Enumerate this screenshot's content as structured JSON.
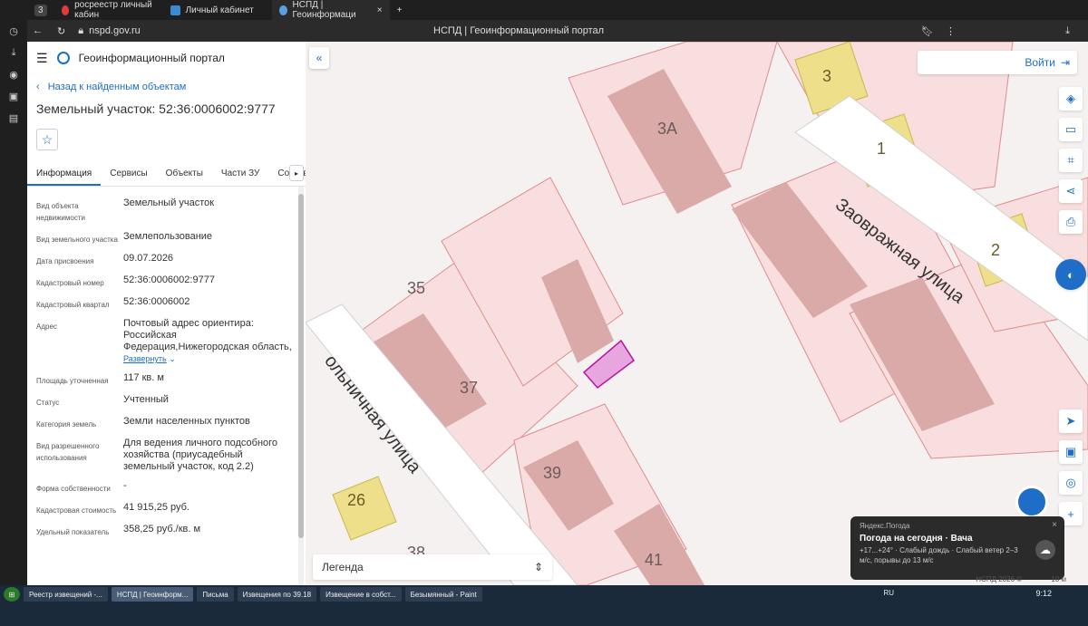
{
  "browser": {
    "tabs": [
      {
        "label": "росреестр личный кабин",
        "active": false
      },
      {
        "label": "Личный кабинет",
        "active": false
      },
      {
        "label": "НСПД | Геоинформаци",
        "active": true
      }
    ],
    "tab_count": "3",
    "url": "nspd.gov.ru",
    "page_title": "НСПД | Геоинформационный портал",
    "login_badge": "Войти"
  },
  "panel": {
    "portal_name": "Геоинформационный портал",
    "back_label": "Назад к найденным объектам",
    "title": "Земельный участок: 52:36:0006002:9777",
    "tabs": [
      "Информация",
      "Сервисы",
      "Объекты",
      "Части ЗУ",
      "Состав"
    ],
    "properties": [
      {
        "key": "Вид объекта недвижимости",
        "value": "Земельный участок"
      },
      {
        "key": "Вид земельного участка",
        "value": "Землепользование"
      },
      {
        "key": "Дата присвоения",
        "value": "09.07.2026"
      },
      {
        "key": "Кадастровый номер",
        "value": "52:36:0006002:9777"
      },
      {
        "key": "Кадастровый квартал",
        "value": "52:36:0006002"
      },
      {
        "key": "Адрес",
        "value": "Почтовый адрес ориентира: Российская Федерация,Нижегородская область,"
      },
      {
        "key": "Площадь уточненная",
        "value": "117 кв. м"
      },
      {
        "key": "Статус",
        "value": "Учтенный"
      },
      {
        "key": "Категория земель",
        "value": "Земли населенных пунктов"
      },
      {
        "key": "Вид разрешенного использования",
        "value": "Для ведения личного подсобного хозяйства (приусадебный земельный участок, код 2.2)"
      },
      {
        "key": "Форма собственности",
        "value": "-"
      },
      {
        "key": "Кадастровая стоимость",
        "value": "41 915,25 руб."
      },
      {
        "key": "Удельный показатель",
        "value": "358,25 руб./кв. м"
      }
    ],
    "expand_label": "Развернуть"
  },
  "map": {
    "login_label": "Войти",
    "legend_label": "Легенда",
    "streets": [
      "Заовражная улица",
      "ольничная улица"
    ],
    "house_numbers": [
      "3",
      "3А",
      "1",
      "2",
      "35",
      "37",
      "39",
      "26",
      "38",
      "41"
    ],
    "scale_label": "10 м",
    "copyright": "НСПД 2026 ©"
  },
  "weather": {
    "source": "Яндекс.Погода",
    "headline": "Погода на сегодня · Вача",
    "details": "+17...+24° · Слабый дождь · Слабый ветер 2–3 м/с, порывы до 13 м/с"
  },
  "taskbar": {
    "items": [
      {
        "label": "Реестр извещений -...",
        "active": false
      },
      {
        "label": "НСПД | Геоинформ...",
        "active": true
      },
      {
        "label": "Письма",
        "active": false
      },
      {
        "label": "Извещения по 39.18",
        "active": false
      },
      {
        "label": "Извещение в собст...",
        "active": false
      },
      {
        "label": "Безымянный - Paint",
        "active": false
      }
    ],
    "lang": "RU",
    "clock": "9:12"
  },
  "colors": {
    "accent": "#1e6ec8",
    "parcel_fill": "#f8dede",
    "parcel_stroke": "#e08c8c",
    "building": "#d9aaa8",
    "selected": "#e7a6e0",
    "yellow_building": "#eee08a"
  }
}
